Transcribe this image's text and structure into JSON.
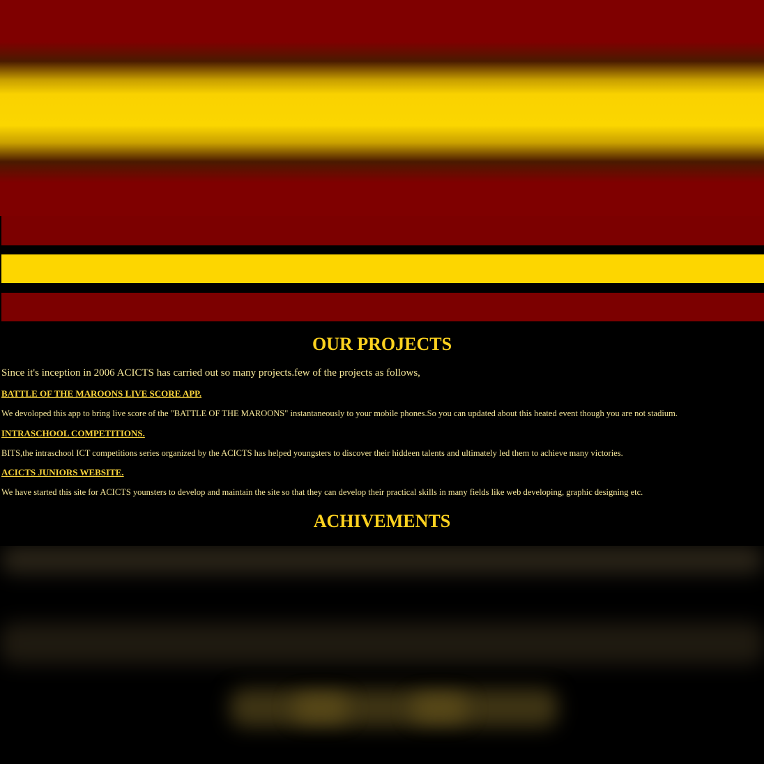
{
  "colors": {
    "maroon": "#7c0000",
    "gold": "#fdd600",
    "background": "#000000",
    "title_text": "#fdd21f",
    "body_text": "#f6e79a"
  },
  "projects": {
    "title": "OUR PROJECTS",
    "intro": "Since it's inception in 2006 ACICTS has carried out so many projects.few of the projects as follows,",
    "items": [
      {
        "heading": "BATTLE OF THE MAROONS LIVE SCORE APP.",
        "description": "We devoloped this app to bring live score of the \"BATTLE OF THE MAROONS\" instantaneously to your mobile phones.So you can updated about this heated event though you are not stadium."
      },
      {
        "heading": "INTRASCHOOL COMPETITIONS.",
        "description": "BITS,the intraschool ICT competitions series organized by the ACICTS has helped youngsters to discover their hiddeen talents and ultimately led them  to achieve many victories."
      },
      {
        "heading": "ACICTS JUNIORS WEBSITE.",
        "description": "We have started this site for ACICTS younsters to develop and maintain the site so that they can develop their practical skills in many fields like web developing, graphic designing etc."
      }
    ]
  },
  "achievements": {
    "title": "ACHIVEMENTS"
  }
}
